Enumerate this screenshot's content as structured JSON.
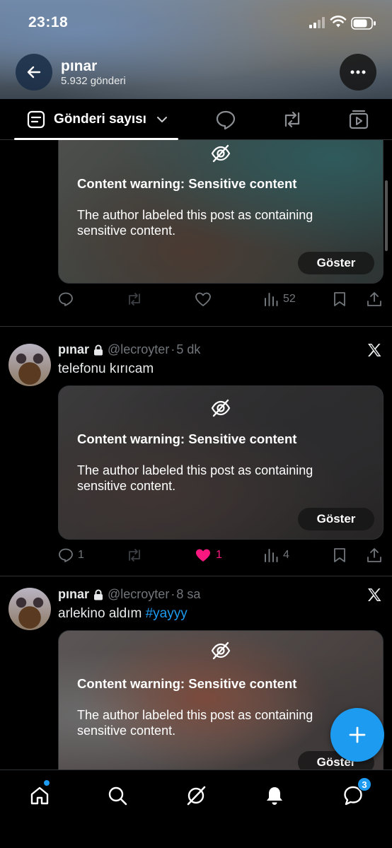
{
  "status_bar": {
    "time": "23:18"
  },
  "profile": {
    "name": "pınar",
    "post_count": "5.932 gönderi"
  },
  "tabs": {
    "active_label": "Gönderi sayısı"
  },
  "content_warning": {
    "title": "Content warning: Sensitive content",
    "text": "The author labeled this post as containing sensitive content.",
    "show_label": "Göster"
  },
  "posts": [
    {
      "actions": {
        "replies": "",
        "reposts": "",
        "likes": "",
        "views": "52"
      }
    },
    {
      "name": "pınar",
      "handle": "@lecroyter",
      "dot": "·",
      "time": "5 dk",
      "text": "telefonu kırıcam",
      "actions": {
        "replies": "1",
        "reposts": "",
        "likes": "1",
        "views": "4",
        "liked": true
      }
    },
    {
      "name": "pınar",
      "handle": "@lecroyter",
      "dot": "·",
      "time": "8 sa",
      "text": "arlekino aldım ",
      "hashtag": "#yayyy"
    }
  ],
  "nav": {
    "messages_badge": "3"
  },
  "colors": {
    "accent": "#1d9bf0",
    "like": "#f91880",
    "muted": "#71767b",
    "divider": "#2f3336"
  }
}
